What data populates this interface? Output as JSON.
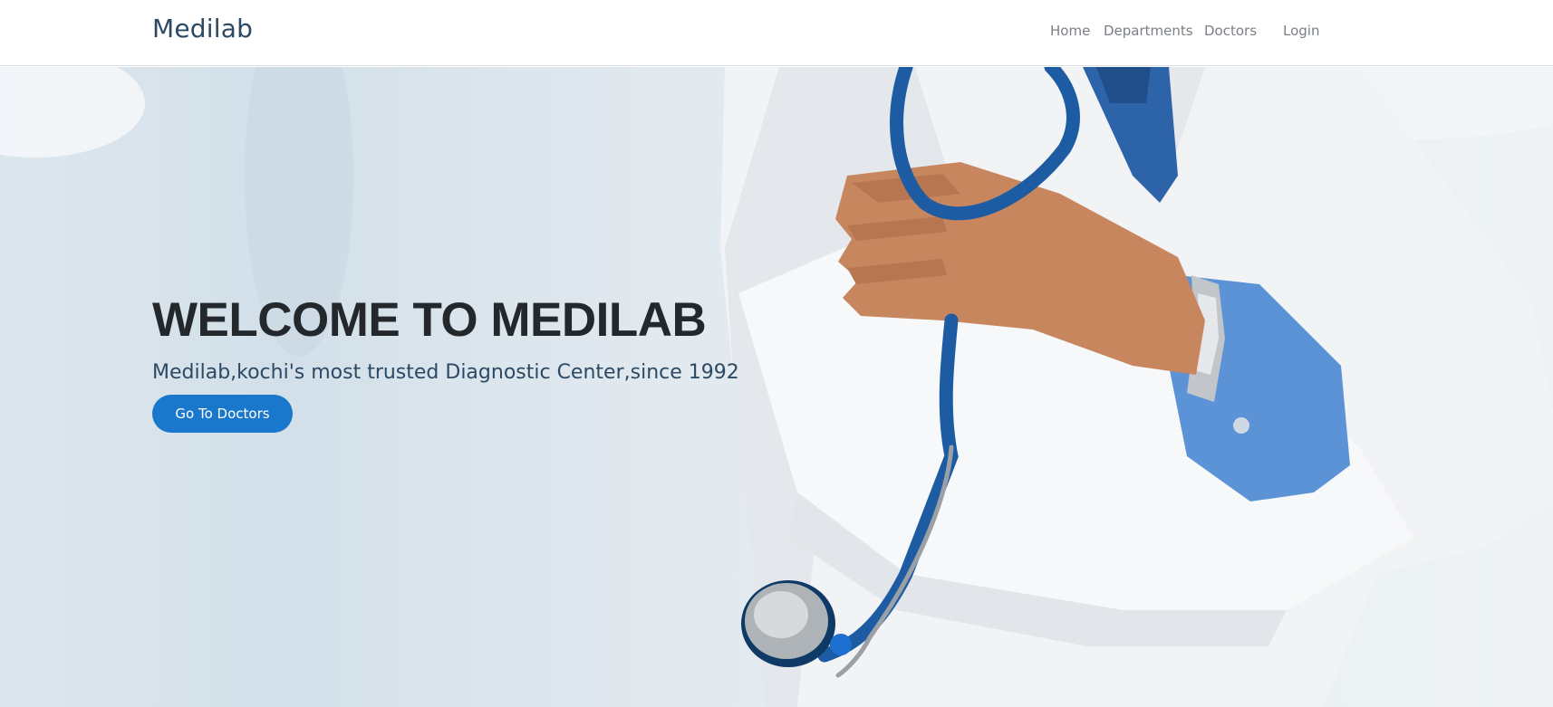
{
  "navbar": {
    "brand": "Medilab",
    "links": [
      {
        "label": "Home"
      },
      {
        "label": "Departments"
      },
      {
        "label": "Doctors"
      },
      {
        "label": "Login"
      }
    ]
  },
  "hero": {
    "title": "WELCOME TO MEDILAB",
    "subtitle": "Medilab,kochi's most trusted Diagnostic Center,since 1992",
    "cta_label": "Go To Doctors",
    "image": "doctor-with-stethoscope"
  },
  "colors": {
    "brand_text": "#2c4964",
    "accent": "#1977cc",
    "nav_text": "#7a7f86",
    "title_text": "#23282c"
  }
}
